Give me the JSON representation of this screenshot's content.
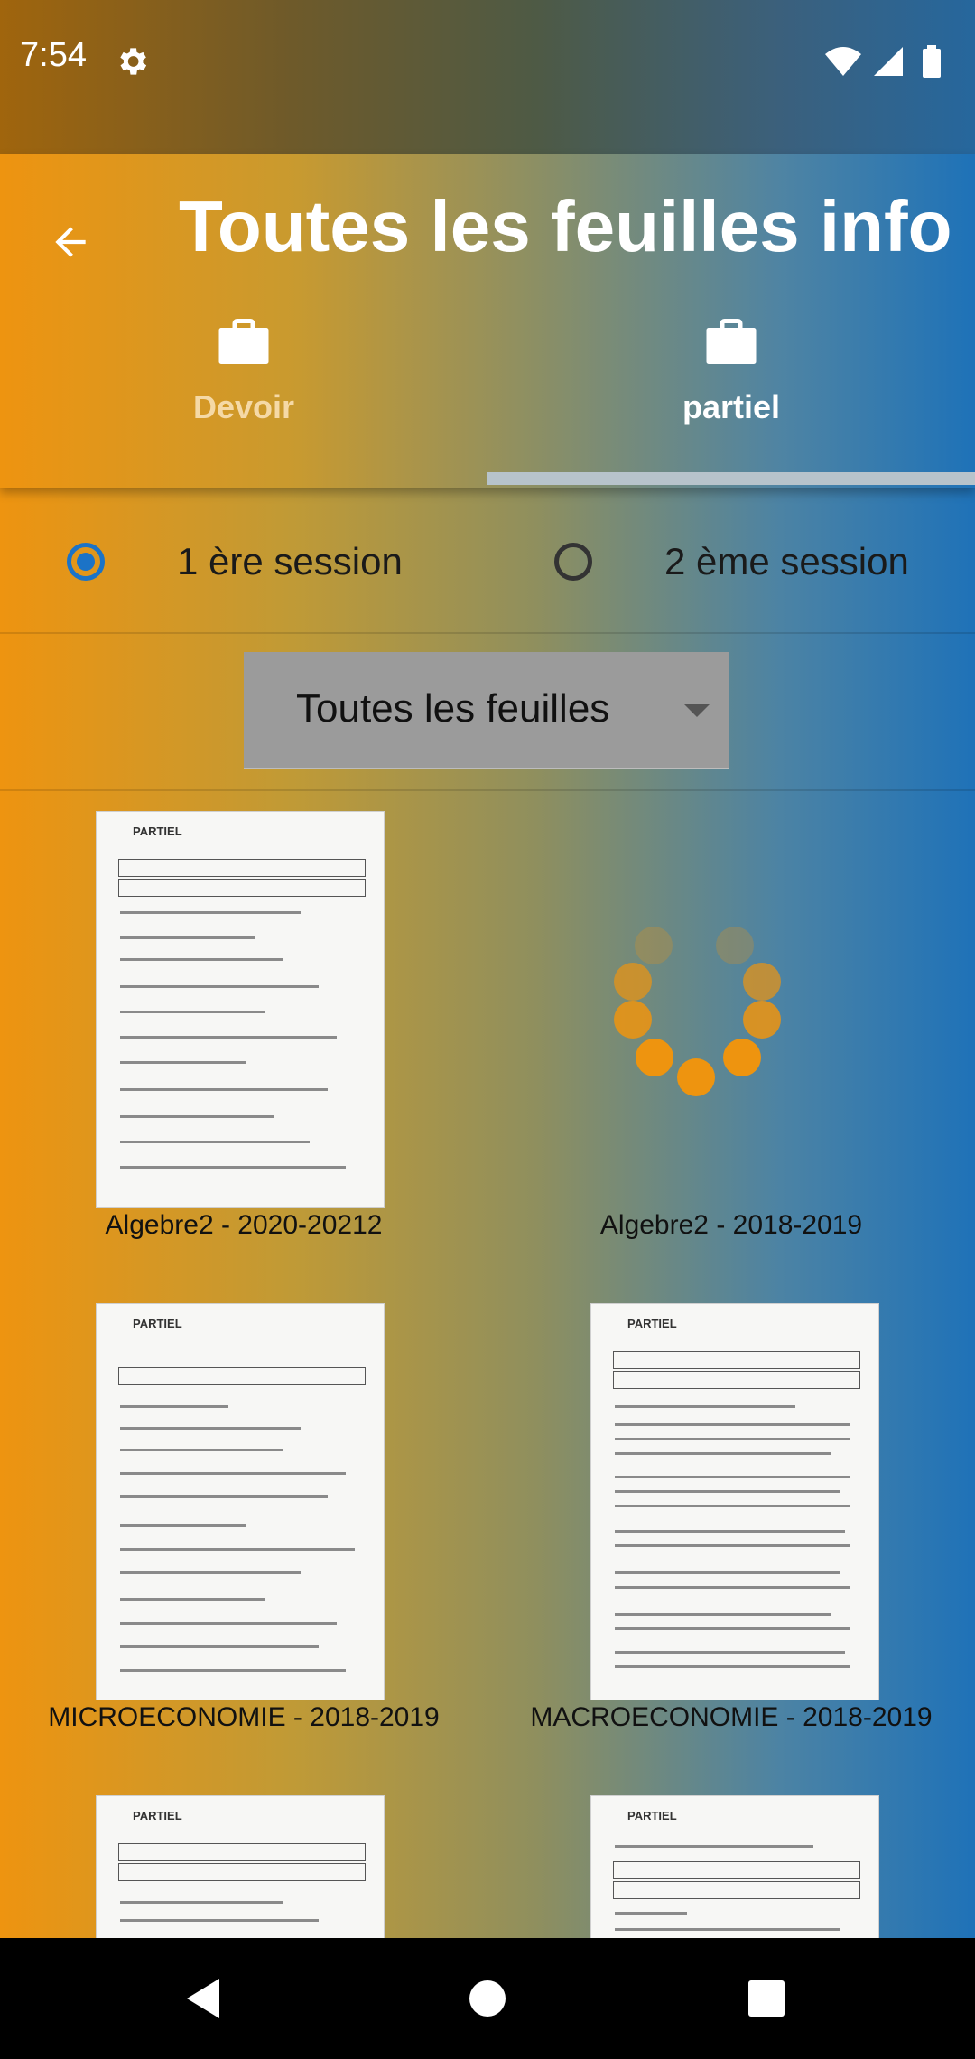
{
  "status_bar": {
    "time": "7:54"
  },
  "app_bar": {
    "title": "Toutes les feuilles info"
  },
  "tabs": [
    {
      "label": "Devoir",
      "icon": "briefcase-icon",
      "selected": false
    },
    {
      "label": "partiel",
      "icon": "briefcase-icon",
      "selected": true
    }
  ],
  "sessions": {
    "options": [
      {
        "label": "1 ère session",
        "selected": true
      },
      {
        "label": "2 ème session",
        "selected": false
      }
    ]
  },
  "filter": {
    "selected": "Toutes les feuilles"
  },
  "documents": [
    {
      "label": "Algebre2 - 2020-20212",
      "loading": false
    },
    {
      "label": "Algebre2 - 2018-2019",
      "loading": true
    },
    {
      "label": "MICROECONOMIE - 2018-2019",
      "loading": false
    },
    {
      "label": "MACROECONOMIE - 2018-2019",
      "loading": false
    },
    {
      "label": "",
      "loading": false
    },
    {
      "label": "",
      "loading": false
    }
  ],
  "doc_thumbnail_text": {
    "heading": "PARTIEL"
  },
  "colors": {
    "accent_orange": "#ee9410",
    "accent_blue": "#1f72b8",
    "radio_selected": "#1b73c7"
  }
}
